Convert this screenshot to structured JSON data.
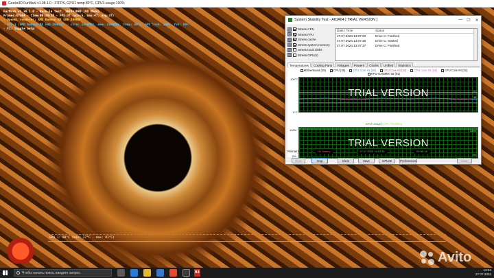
{
  "furmark": {
    "window_title": "Geeks3D FurMark v1.38.1.0 - 37FPS, GPU1 temp:80°C, GPU1 usage:100%",
    "overlay": [
      {
        "text": "FurMark v1.38.1.0 - Burn-in test, 1920x1080 (0X MSAA)",
        "color": "#ffffff"
      },
      {
        "text": "Frames:67384 - time:00:30:38 - FPS:37 (min:5, max:47, avg:37)",
        "color": "#ffffff"
      },
      {
        "text": "- OpenGL renderer: AMD Radeon RX 580 2048SP",
        "color": "#ffd84a"
      },
      {
        "text": "- GPU 1 (AMD Radeon RX 580 2048SP) - core: 1290MHz, mem: 1500MHz, temp: 80°C, GPU load: 100%, fan: 66%",
        "color": "#4cc3ff"
      },
      {
        "text": "- F1: toggle help",
        "color": "#ffffff"
      }
    ],
    "graph_label": "GPU 1: 80°C (min: 37°C - max: 81°C)"
  },
  "aida": {
    "title": "System Stability Test - AIDA64  [ TRIAL VERSION ]",
    "stress_items": [
      {
        "label": "Stress CPU",
        "checked": true
      },
      {
        "label": "Stress FPU",
        "checked": true
      },
      {
        "label": "Stress cache",
        "checked": true
      },
      {
        "label": "Stress system memory",
        "checked": true
      },
      {
        "label": "Stress local disks",
        "checked": false
      },
      {
        "label": "Stress GPU(s)",
        "checked": false
      }
    ],
    "log": {
      "col_date": "Date / Time",
      "col_status": "Status",
      "rows": [
        {
          "date": "27.07.2024 13:07:20",
          "status": "Drive C: Finished"
        },
        {
          "date": "27.07.2024 13:07:36",
          "status": "Drive C: Started"
        },
        {
          "date": "27.07.2024 13:07:37",
          "status": "Drive C: Finished"
        }
      ]
    },
    "tabs": [
      "Temperatures",
      "Cooling Fans",
      "Voltages",
      "Powers",
      "Clocks",
      "Unified",
      "Statistics"
    ],
    "temp_legend": [
      {
        "label": "Motherboard (28)",
        "color": "#ffffff"
      },
      {
        "label": "CPU (35)",
        "color": "#ffffff"
      },
      {
        "label": "CPU Core #1 (36)",
        "color": "#3c8cff"
      },
      {
        "label": "CPU Core #2 (33)",
        "color": "#ff4040"
      },
      {
        "label": "CPU Core #3 (34)",
        "color": "#ff44ff"
      },
      {
        "label": "CPU Core #4 (31)",
        "color": "#ffffff"
      },
      {
        "label": "KFG-GAMMIX S5 (51)",
        "color": "#ffffff"
      }
    ],
    "temp_graph": {
      "y_top": "100°C",
      "y_bottom": "0°C",
      "right_values": [
        "51",
        "36"
      ],
      "watermark": "TRIAL VERSION"
    },
    "usage_graph": {
      "title_a": "CPU Usage",
      "sep": "|",
      "title_b": "CPU Throttling",
      "y_top": "100%",
      "y_bottom": "0%",
      "right_top": "100%",
      "right_bottom": "0%",
      "watermark": "TRIAL VERSION"
    },
    "status": {
      "battery_label": "Remaining Battery:",
      "battery_value": "No battery",
      "started_label": "Test Started:",
      "started_value": "27.07.2024 13:03:51",
      "elapsed_label": "Elapsed Time:",
      "elapsed_value": "00:30:18"
    },
    "buttons": {
      "start": "Start",
      "stop": "Stop",
      "clear": "Clear",
      "save": "Save",
      "cpuid": "CPUID",
      "preferences": "Preferences",
      "close": "Close"
    }
  },
  "taskbar": {
    "search_placeholder": "Чтобы начать поиск, введите запрос",
    "badge": "64",
    "time": "13:34",
    "date": "27.07.2024"
  },
  "watermark": {
    "text": "Avito"
  }
}
